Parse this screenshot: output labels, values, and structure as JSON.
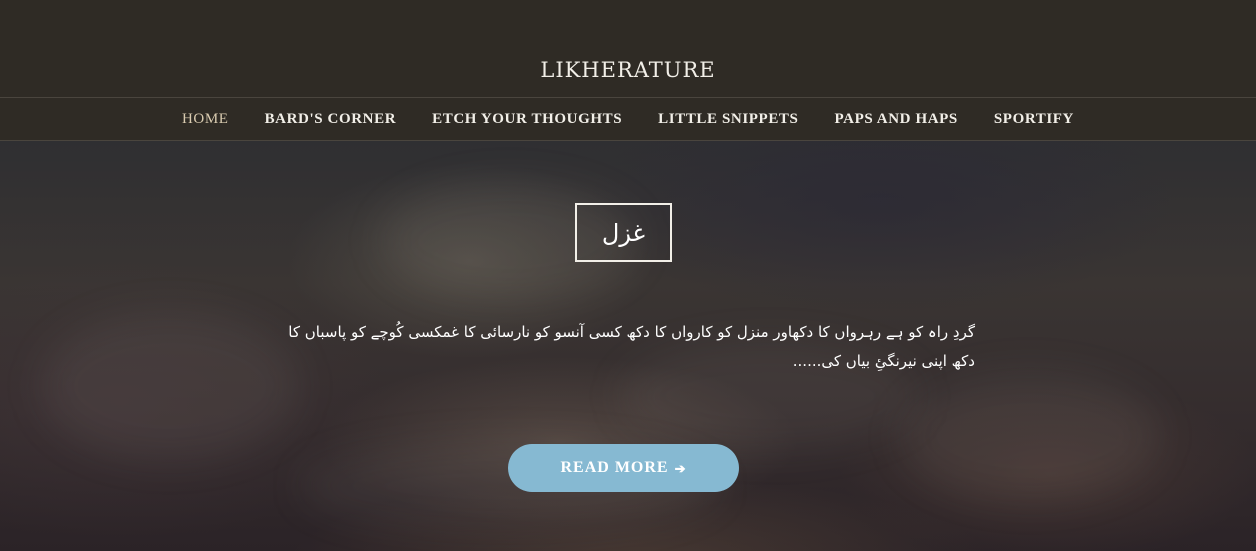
{
  "site": {
    "title": "LIKHERATURE"
  },
  "nav": {
    "items": [
      {
        "label": "HOME",
        "active": true
      },
      {
        "label": "BARD'S CORNER"
      },
      {
        "label": "ETCH YOUR THOUGHTS"
      },
      {
        "label": "LITTLE SNIPPETS"
      },
      {
        "label": "PAPS AND HAPS"
      },
      {
        "label": "SPORTIFY"
      }
    ]
  },
  "post": {
    "category": "غزل",
    "excerpt": "گردِ راہ کو ہے رہرواں کا دکھاور منزل کو کارواں کا دکھ کسی آنسو کو نارسائی کا غمکسی کُوچے کو پاسباں کا دکھ اپنی نیرنگئِ بیاں کی......",
    "read_more_label": "READ MORE",
    "read_more_icon": "arrow-right-icon"
  },
  "colors": {
    "header_bg": "#2f2b25",
    "button_bg": "#86b9d2",
    "active_nav": "#d9cbb0"
  }
}
